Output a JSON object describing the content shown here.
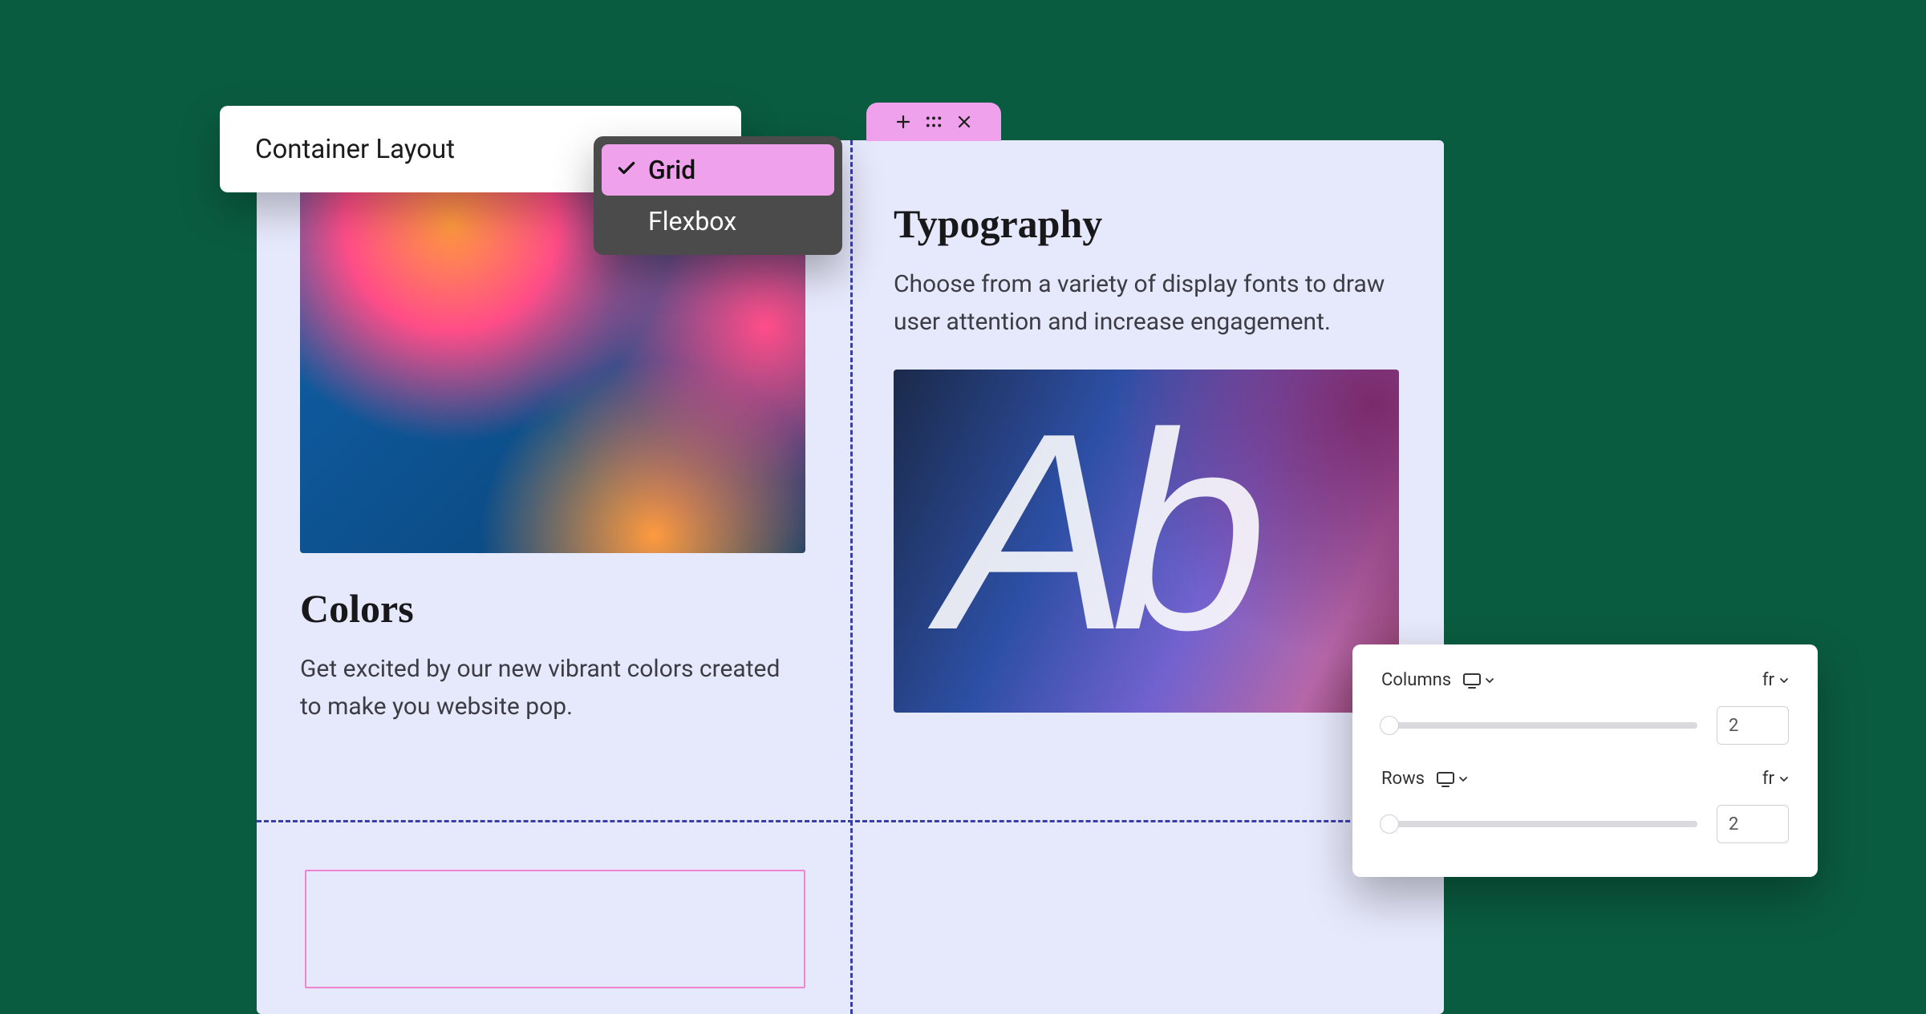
{
  "layoutCard": {
    "label": "Container Layout"
  },
  "dropdown": {
    "options": [
      {
        "label": "Grid",
        "selected": true
      },
      {
        "label": "Flexbox",
        "selected": false
      }
    ]
  },
  "toolbarTab": {
    "icons": [
      "plus-icon",
      "drag-handle-icon",
      "close-icon"
    ]
  },
  "cells": {
    "colors": {
      "heading": "Colors",
      "body": "Get excited by our new vibrant colors created to make you website pop."
    },
    "typography": {
      "heading": "Typography",
      "body": "Choose from a variety of display fonts to draw user attention and increase engagement.",
      "sample": "Ab"
    }
  },
  "sliders": {
    "rows": [
      {
        "label": "Columns",
        "unit": "fr",
        "value": "2"
      },
      {
        "label": "Rows",
        "unit": "fr",
        "value": "2"
      }
    ]
  }
}
